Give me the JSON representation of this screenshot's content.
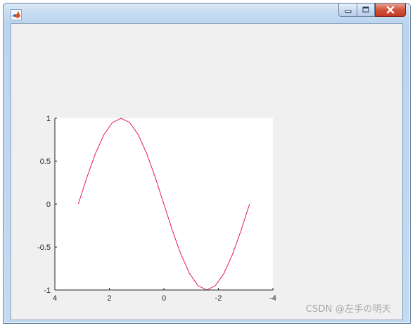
{
  "window": {
    "title": "",
    "icon": "matlab-figure-icon",
    "controls": [
      "minimize",
      "maximize",
      "close"
    ]
  },
  "colors": {
    "line": "#e8175d",
    "axes_bg": "#ffffff",
    "figure_bg": "#f0f0f0",
    "axis": "#262626"
  },
  "chart_data": {
    "type": "line",
    "title": "",
    "xlabel": "",
    "ylabel": "",
    "xlim": [
      -4,
      4
    ],
    "ylim": [
      -1,
      1
    ],
    "x_direction": "reverse",
    "grid": false,
    "box": false,
    "xticks": [
      4,
      2,
      0,
      -2,
      -4
    ],
    "xtick_labels": [
      "4",
      "2",
      "0",
      "-2",
      "-4"
    ],
    "yticks": [
      1,
      0.5,
      0,
      -0.5,
      -1
    ],
    "ytick_labels": [
      "1",
      "0.5",
      "0",
      "-0.5",
      "-1"
    ],
    "series": [
      {
        "color": "#e8175d",
        "x": [
          -3.1416,
          -2.8274,
          -2.5133,
          -2.1991,
          -1.885,
          -1.5708,
          -1.2566,
          -0.9425,
          -0.6283,
          -0.3142,
          0,
          0.3142,
          0.6283,
          0.9425,
          1.2566,
          1.5708,
          1.885,
          2.1991,
          2.5133,
          2.8274,
          3.1416
        ],
        "y": [
          0,
          -0.309,
          -0.5878,
          -0.809,
          -0.9511,
          -1,
          -0.9511,
          -0.809,
          -0.5878,
          -0.309,
          0,
          0.309,
          0.5878,
          0.809,
          0.9511,
          1,
          0.9511,
          0.809,
          0.5878,
          0.309,
          0
        ]
      }
    ]
  },
  "watermark": "CSDN @左手の明天"
}
